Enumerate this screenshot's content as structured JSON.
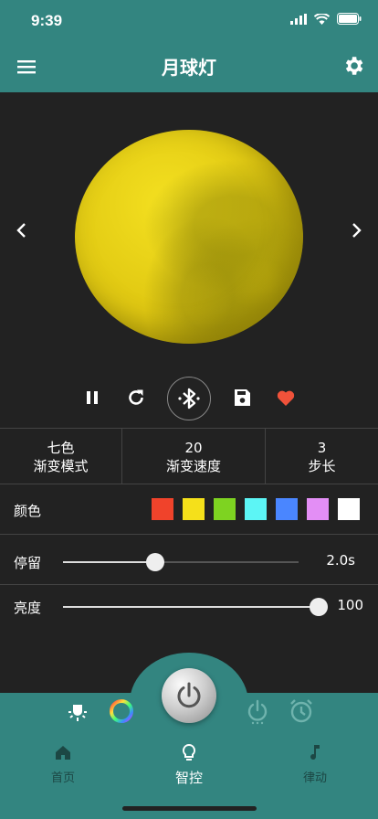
{
  "status_bar": {
    "time": "9:39"
  },
  "app_bar": {
    "title": "月球灯"
  },
  "lamp": {
    "preview_color": "#E8D214"
  },
  "params": [
    {
      "value": "七色",
      "label": "渐变模式"
    },
    {
      "value": "20",
      "label": "渐变速度"
    },
    {
      "value": "3",
      "label": "步长"
    }
  ],
  "colors": {
    "label": "颜色",
    "swatches": [
      "#F0432B",
      "#F5E01A",
      "#7ED321",
      "#5CF5F5",
      "#4A86FF",
      "#E38EF5",
      "#FFFFFF"
    ]
  },
  "stay": {
    "label": "停留",
    "value_text": "2.0s",
    "level": 0.39
  },
  "brightness": {
    "label": "亮度",
    "value_text": "100",
    "level": 1.0
  },
  "tabs": [
    {
      "label": "首页",
      "icon": "home-icon",
      "active": false
    },
    {
      "label": "智控",
      "icon": "bulb-icon",
      "active": true
    },
    {
      "label": "律动",
      "icon": "music-note-icon",
      "active": false
    }
  ],
  "theme": {
    "accent": "#338580",
    "background": "#222222",
    "heart": "#F0523A"
  }
}
